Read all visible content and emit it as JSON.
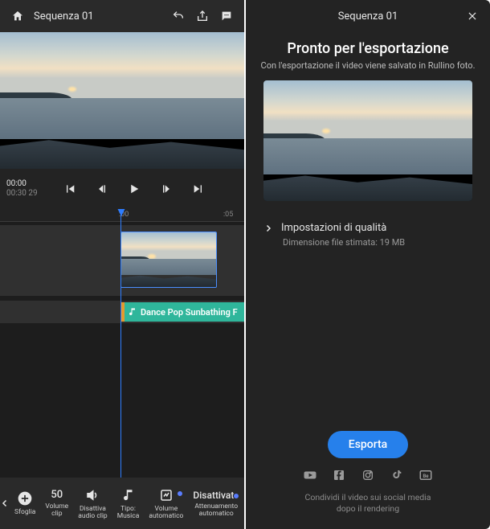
{
  "left": {
    "sequenceTitle": "Sequenza 01",
    "time": {
      "current": "00:00",
      "total": "00:30",
      "frames": "29"
    },
    "ruler": {
      "tick0": ":00",
      "tick1": ":05"
    },
    "audioClip": {
      "label": "Dance Pop Sunbathing F"
    },
    "tools": {
      "browse": "Sfoglia",
      "volumeClip": {
        "value": "50",
        "label": "Volume\nclip"
      },
      "muteClip": "Disattiva\naudio clip",
      "type": "Tipo:\nMusica",
      "autoVolume": "Volume\nautomatico",
      "autoDuck": {
        "value": "Disattivato",
        "label": "Attenuamento\nautomatico"
      }
    }
  },
  "right": {
    "sequenceTitle": "Sequenza 01",
    "heading": "Pronto per l'esportazione",
    "subheading": "Con l'esportazione il video viene salvato in Rullino foto.",
    "qualityLabel": "Impostazioni di qualità",
    "estimatedSize": "Dimensione file stimata: 19 MB",
    "exportButton": "Esporta",
    "shareNote1": "Condividi il video sui social media",
    "shareNote2": "dopo il rendering"
  }
}
